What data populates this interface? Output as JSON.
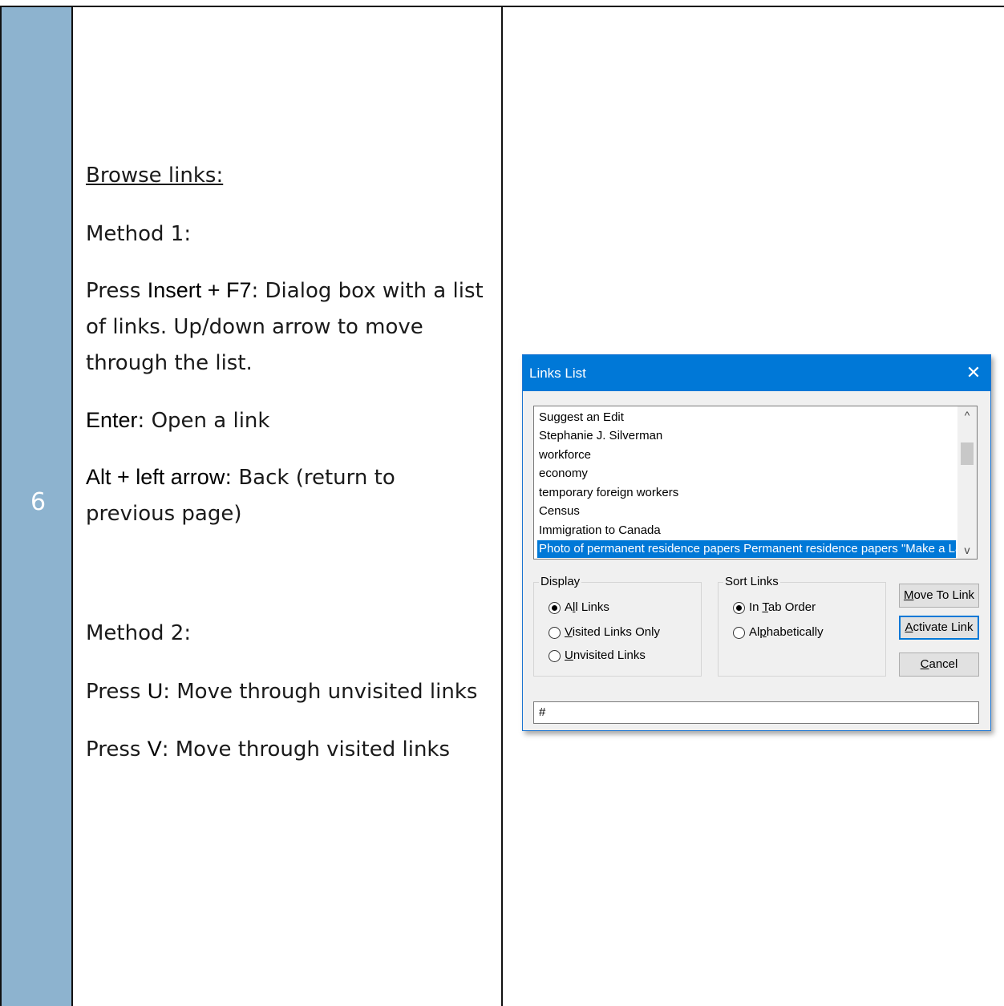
{
  "row": {
    "step_number": "6",
    "heading": "Browse links:",
    "method1_label": "Method 1:",
    "method1_press_prefix": "Press ",
    "method1_key": "Insert + F7",
    "method1_desc": ": Dialog box with a list of links. Up/down arrow to move through the list.",
    "enter_key": "Enter",
    "enter_desc": ": Open a link",
    "alt_key": "Alt + left arrow",
    "alt_desc": ": Back (return to previous page)",
    "method2_label": "Method 2:",
    "u_prefix": "Press ",
    "u_key": "U",
    "u_desc": ": Move through unvisited links",
    "v_prefix": "Press ",
    "v_key": "V",
    "v_desc": ": Move through visited links"
  },
  "dialog": {
    "title": "Links List",
    "close_glyph": "✕",
    "links": [
      "Suggest an Edit",
      "Stephanie J. Silverman",
      "workforce",
      "economy",
      "temporary foreign workers",
      "Census",
      "Immigration to Canada",
      "Photo of permanent residence papers Permanent residence papers \"Make a Lan..."
    ],
    "selected_index": 7,
    "scroll_up_glyph": "^",
    "scroll_down_glyph": "v",
    "display_group": {
      "label": "Display",
      "options": [
        {
          "pre": "A",
          "u": "l",
          "post": "l Links",
          "checked": true
        },
        {
          "pre": "",
          "u": "V",
          "post": "isited Links Only",
          "checked": false
        },
        {
          "pre": "",
          "u": "U",
          "post": "nvisited Links",
          "checked": false
        }
      ]
    },
    "sort_group": {
      "label": "Sort Links",
      "options": [
        {
          "pre": "In ",
          "u": "T",
          "post": "ab Order",
          "checked": true
        },
        {
          "pre": "Al",
          "u": "p",
          "post": "habetically",
          "checked": false
        }
      ]
    },
    "buttons": {
      "move": {
        "u": "M",
        "post": "ove To Link"
      },
      "activate": {
        "u": "A",
        "post": "ctivate Link"
      },
      "cancel": {
        "u": "C",
        "post": "ancel"
      }
    },
    "filter_value": "#"
  }
}
